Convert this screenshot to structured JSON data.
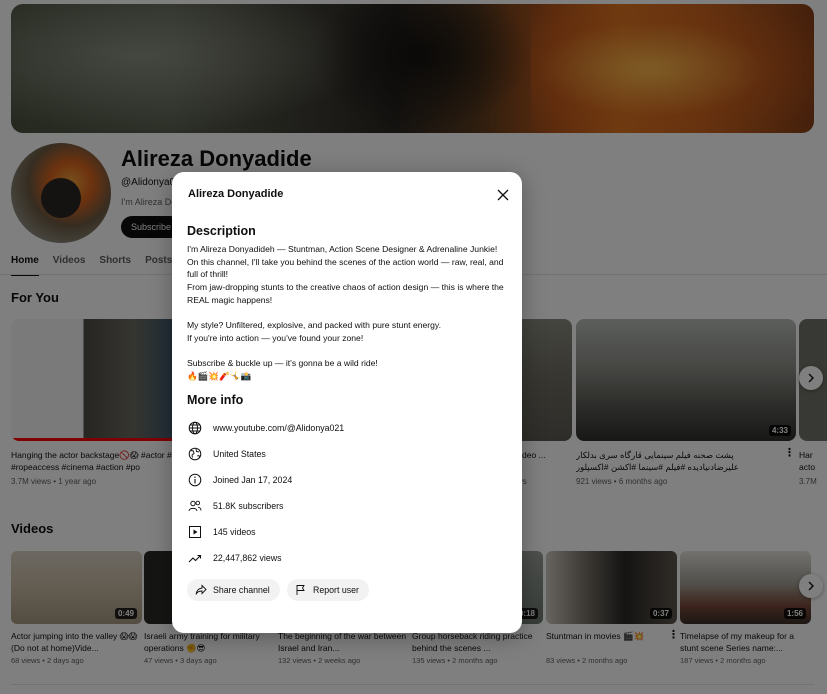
{
  "channel": {
    "name": "Alireza Donyadide",
    "handle": "@Alidonya021",
    "short_desc": "I'm Alireza Do",
    "subscribe_label": "Subscribe"
  },
  "tabs": [
    {
      "label": "Home"
    },
    {
      "label": "Videos"
    },
    {
      "label": "Shorts"
    },
    {
      "label": "Posts"
    }
  ],
  "sections": {
    "for_you": "For You",
    "videos": "Videos"
  },
  "for_you_videos": [
    {
      "title": "Hanging the actor backstage🚫😱 #actor #stunt #ropeaccess #cinema #action #po",
      "meta": "3.7M views • 1 year ago"
    },
    {
      "title": "deo ...",
      "meta": "ws"
    },
    {
      "title": "پشت صحنه فیلم سینمایی قارگاه سری بدلکار علیرضادنیادیده #فیلم #سینما #اکشن #اکسپلور #viralvideo",
      "meta": "921 views • 6 months ago",
      "duration": "4:33"
    },
    {
      "title": "Har acto",
      "meta": "3.7M"
    }
  ],
  "videos": [
    {
      "title": "Actor jumping into the valley 😱😱(Do not at home)Vide...",
      "meta": "68 views • 2 days ago",
      "duration": "0:49"
    },
    {
      "title": "Israeli army training for military operations ✊😎",
      "meta": "47 views • 3 days ago"
    },
    {
      "title": "The beginning of the war between Israel and Iran...",
      "meta": "132 views • 2 weeks ago"
    },
    {
      "title": "Group horseback riding practice behind the scenes ...",
      "meta": "135 views • 2 months ago",
      "duration": "0:18"
    },
    {
      "title": "Stuntman in movies 🎬💥",
      "meta": "83 views • 2 months ago",
      "duration": "0:37"
    },
    {
      "title": "Timelapse of my makeup for a stunt scene Series name:...",
      "meta": "187 views • 2 months ago",
      "duration": "1:56"
    }
  ],
  "dialog": {
    "title": "Alireza Donyadide",
    "description_heading": "Description",
    "description_lines": [
      "I'm Alireza Donyadideh — Stuntman, Action Scene Designer & Adrenaline Junkie!",
      "On this channel, I'll take you behind the scenes of the action world — raw, real, and full of thrill!",
      "From jaw-dropping stunts to the creative chaos of action design — this is where the REAL magic happens!",
      "",
      "My style? Unfiltered, explosive, and packed with pure stunt energy.",
      "If you're into action — you've found your zone!",
      "",
      "Subscribe & buckle up — it's gonna be a wild ride!",
      "🔥🎬💥🧨🤸📸"
    ],
    "more_info_heading": "More info",
    "info": {
      "url": "www.youtube.com/@Alidonya021",
      "country": "United States",
      "joined": "Joined Jan 17, 2024",
      "subscribers": "51.8K subscribers",
      "videos": "145 videos",
      "views": "22,447,862 views"
    },
    "share_label": "Share channel",
    "report_label": "Report user"
  },
  "icons": {
    "close": "close-icon",
    "globe": "globe-icon",
    "country": "country-icon",
    "info": "info-icon",
    "subscribers": "subscribers-icon",
    "videos": "play-square-icon",
    "views": "trending-icon",
    "share": "share-icon",
    "flag": "flag-icon",
    "next": "chevron-right-icon"
  }
}
